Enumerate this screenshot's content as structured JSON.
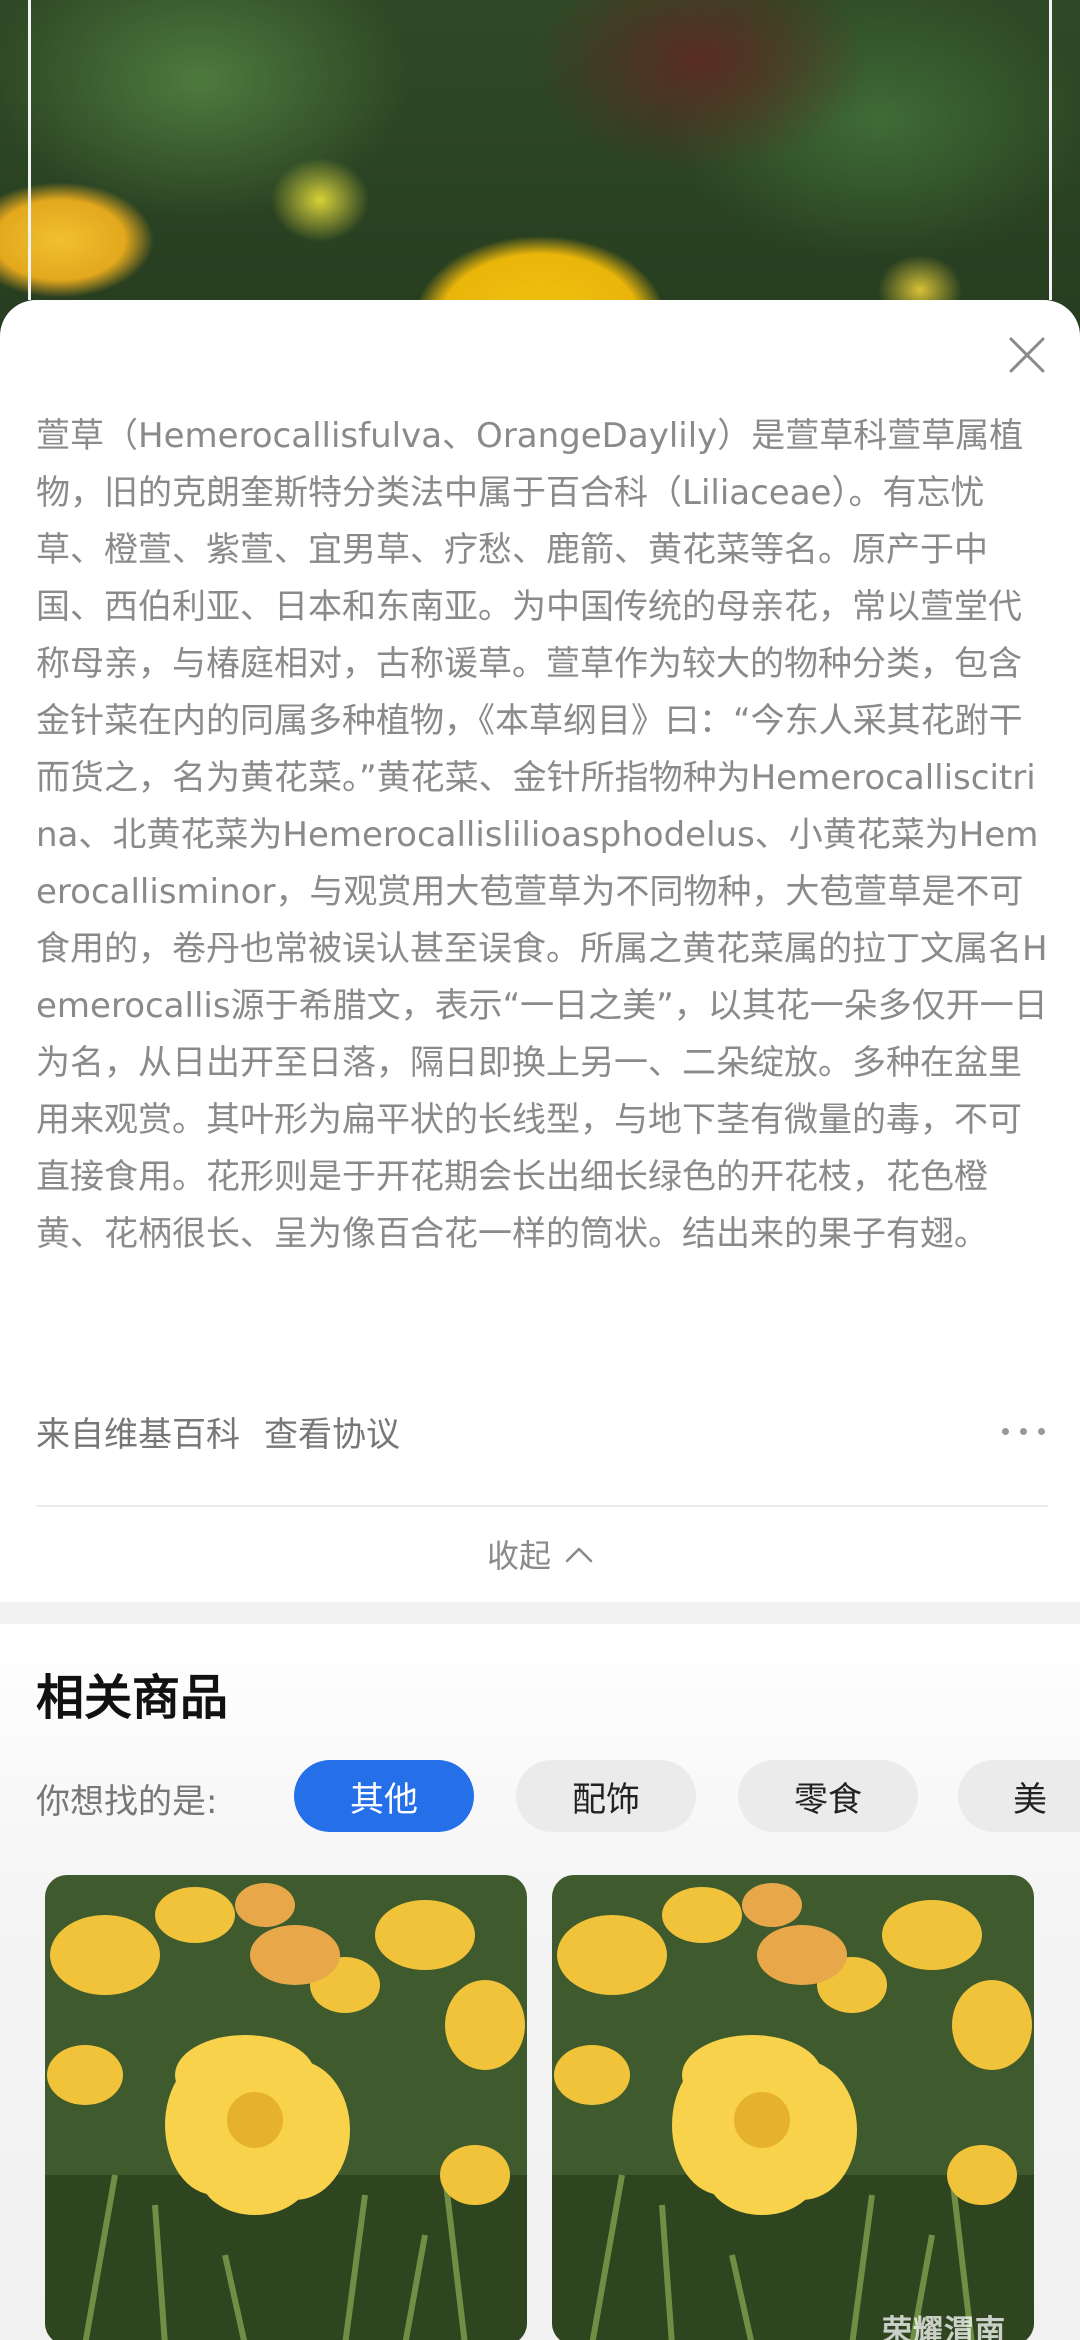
{
  "article": {
    "text": "萱草（Hemerocallisfulva、OrangeDaylily）是萱草科萱草属植物，旧的克朗奎斯特分类法中属于百合科（Liliaceae）。有忘忧草、橙萱、紫萱、宜男草、疗愁、鹿箭、黄花菜等名。原产于中国、西伯利亚、日本和东南亚。为中国传统的母亲花，常以萱堂代称母亲，与椿庭相对，古称谖草。萱草作为较大的物种分类，包含金针菜在内的同属多种植物，《本草纲目》曰：“今东人采其花跗干而货之，名为黄花菜。”黄花菜、金针所指物种为Hemerocalliscitrina、北黄花菜为Hemerocallislilioasphodelus、小黄花菜为Hemerocallisminor，与观赏用大苞萱草为不同物种，大苞萱草是不可食用的，卷丹也常被误认甚至误食。所属之黄花菜属的拉丁文属名Hemerocallis源于希腊文，表示“一日之美”，以其花一朵多仅开一日为名，从日出开至日落，隔日即换上另一、二朵绽放。多种在盆里用来观赏。其叶形为扁平状的长线型，与地下茎有微量的毒，不可直接食用。花形则是于开花期会长出细长绿色的开花枝，花色橙黄、花柄很长、呈为像百合花一样的筒状。结出来的果子有翅。",
    "source": "来自维基百科",
    "protocol": "查看协议",
    "collapse_label": "收起"
  },
  "related": {
    "title": "相关商品",
    "prompt": "你想找的是:",
    "chips": [
      {
        "label": "其他",
        "active": true
      },
      {
        "label": "配饰",
        "active": false
      },
      {
        "label": "零食",
        "active": false
      },
      {
        "label": "美",
        "active": false
      }
    ]
  },
  "watermark": "荣耀渭南",
  "colors": {
    "accent": "#256fe8",
    "body_text": "#8a8a8a",
    "flower_yellow": "#f5cc3a"
  },
  "icons": {
    "close": "close-icon",
    "more": "more-dots-icon",
    "collapse": "chevron-up-icon"
  }
}
